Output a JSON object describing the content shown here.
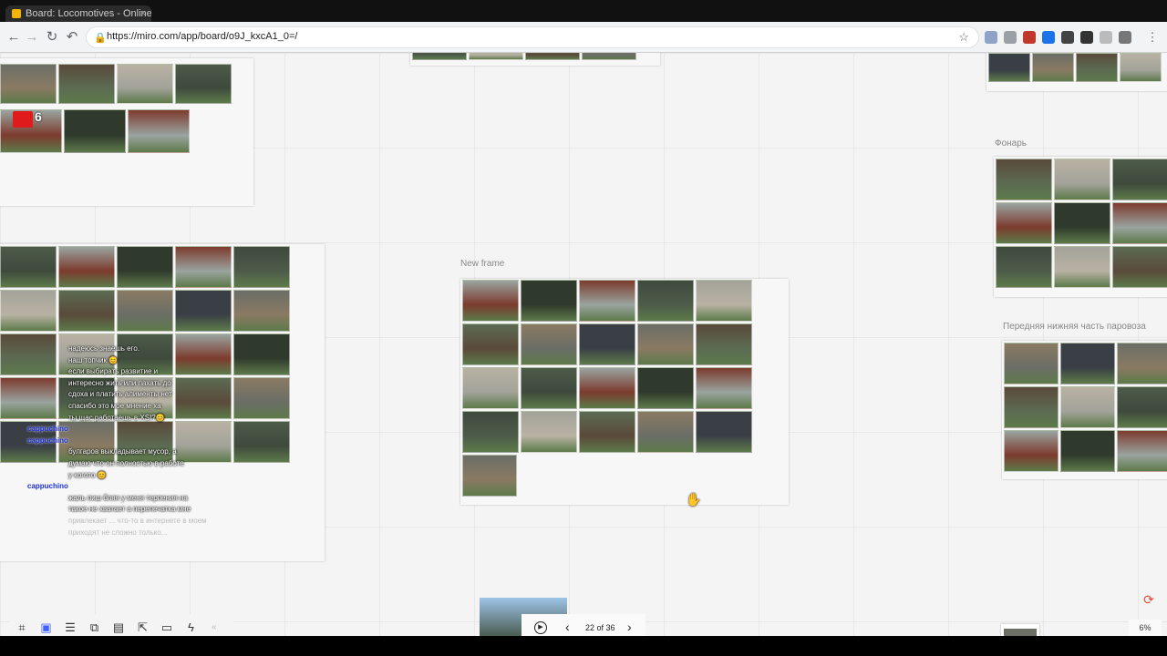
{
  "browser": {
    "tab_title": "Board: Locomotives - Online Whiteb…",
    "tab_close": "×",
    "url": "https://miro.com/app/board/o9J_kxcA1_0=/",
    "lock_icon": "🔒",
    "star_icon": "☆",
    "nav": {
      "back": "←",
      "forward": "→",
      "reload": "↻",
      "undo": "↶"
    }
  },
  "board": {
    "frames": [
      {
        "title": "New frame"
      },
      {
        "title": "Фонарь"
      },
      {
        "title": "Передняя нижняя часть паровоза"
      }
    ],
    "sticker_text": "6"
  },
  "chat": [
    {
      "user": "",
      "text": "надеюсь знаешь его."
    },
    {
      "user": "",
      "text": "наш топчик 😊"
    },
    {
      "user": "",
      "text": "если выбирать развитие и"
    },
    {
      "user": "",
      "text": "интересно жить или пахать до"
    },
    {
      "user": "",
      "text": "сдоха и платить алименты нет"
    },
    {
      "user": "",
      "text": "спасибо это мое мнение ха"
    },
    {
      "user": "",
      "text": "ты щас работаешь в XSI?😊"
    },
    {
      "user": "cappuchino",
      "text": ""
    },
    {
      "user": "cappuchino",
      "text": ""
    },
    {
      "user": "",
      "text": "булгаров выкладывает мусор, а"
    },
    {
      "user": "",
      "text": "думаю что он полностью в работе"
    },
    {
      "user": "",
      "text": "у когото 😊"
    },
    {
      "user": "cappuchino",
      "text": ""
    },
    {
      "user": "",
      "text": "жаль пиш бляя у меня терпения на"
    },
    {
      "user": "",
      "text": "такое не хватает а перепечатка мне"
    },
    {
      "user": "",
      "text": "привлекает ... что-то в интернете в моем"
    },
    {
      "user": "",
      "text": "приходят не сложно только..."
    }
  ],
  "toolbar": {
    "tools": [
      {
        "name": "frames-tool-icon",
        "glyph": "⌗"
      },
      {
        "name": "board-tool-icon",
        "glyph": "▣"
      },
      {
        "name": "comments-tool-icon",
        "glyph": "☰"
      },
      {
        "name": "cards-tool-icon",
        "glyph": "⧉"
      },
      {
        "name": "kanban-tool-icon",
        "glyph": "▤"
      },
      {
        "name": "share-tool-icon",
        "glyph": "⇱"
      },
      {
        "name": "video-tool-icon",
        "glyph": "▭"
      },
      {
        "name": "lightning-tool-icon",
        "glyph": "ϟ"
      }
    ],
    "collapse": "«"
  },
  "presentation": {
    "play_icon": "▶",
    "prev_icon": "‹",
    "next_icon": "›",
    "counter": "22 of 36"
  },
  "zoom": "6%",
  "colors": {
    "canvas_bg": "#f4f4f5",
    "frame_bg": "#f7f7f7",
    "accent": "#4262ff"
  }
}
